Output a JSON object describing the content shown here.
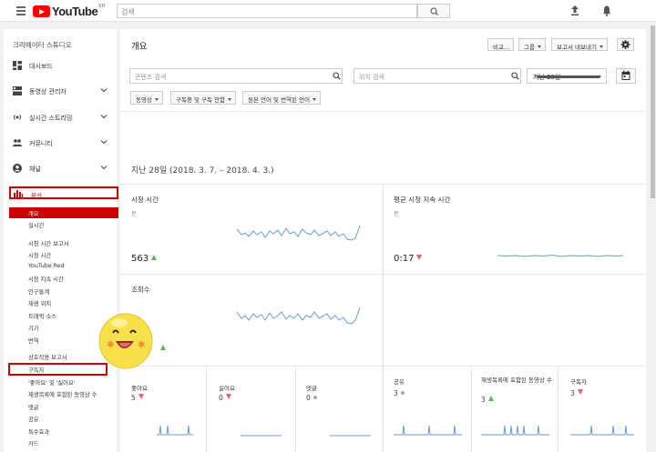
{
  "header": {
    "logo_text": "YouTube",
    "logo_region": "KR",
    "search_placeholder": "검색"
  },
  "sidebar": {
    "title": "크리에이터 스튜디오",
    "items": [
      {
        "label": "대시보드",
        "icon": "dashboard-icon"
      },
      {
        "label": "동영상 관리자",
        "icon": "video-manager-icon"
      },
      {
        "label": "실시간 스트리밍",
        "icon": "live-icon"
      },
      {
        "label": "커뮤니티",
        "icon": "community-icon"
      },
      {
        "label": "채널",
        "icon": "channel-icon"
      }
    ],
    "analytics_label": "분석",
    "sub_items": [
      "개요",
      "실시간",
      "시청 시간 보고서",
      "시청 시간",
      "YouTube Red",
      "시청 지속 시간",
      "인구통계",
      "재생 위치",
      "트래픽 소스",
      "기기",
      "번역",
      "상호작용 보고서",
      "구독자",
      "'좋아요' 및 '싫어요'",
      "재생목록에 포함된 동영상 수",
      "댓글",
      "공유",
      "특수효과",
      "카드"
    ]
  },
  "main": {
    "title": "개요",
    "buttons": {
      "compare": "비교...",
      "group": "그룹",
      "export": "보고서 내보내기"
    },
    "content_search_placeholder": "콘텐츠 검색",
    "location_search_placeholder": "위치 검색",
    "date_range": "지난 28일",
    "filters": [
      "동영상",
      "구독중 및 구독 안함",
      "원본 언어 및 번역된 언어"
    ],
    "period": "지난 28일 (2018. 3. 7. – 2018. 4. 3.)",
    "metrics": {
      "watch_time": {
        "label": "시청 시간",
        "unit": "분",
        "value": "563"
      },
      "avg_duration": {
        "label": "평균 시청 지속 시간",
        "unit": "분",
        "value": "0:17"
      },
      "views": {
        "label": "조회수"
      }
    },
    "engagement": [
      {
        "label": "좋아요",
        "value": "5"
      },
      {
        "label": "싫어요",
        "value": "0"
      },
      {
        "label": "댓글",
        "value": "0"
      },
      {
        "label": "공유",
        "value": "3"
      },
      {
        "label": "재생목록에 포함된 동영상 수",
        "value": "3"
      },
      {
        "label": "구독자",
        "value": "3"
      }
    ]
  },
  "colors": {
    "accent": "#cc0000",
    "spark": "#6b9bd1",
    "up": "#5fb45f",
    "down": "#e06666"
  }
}
